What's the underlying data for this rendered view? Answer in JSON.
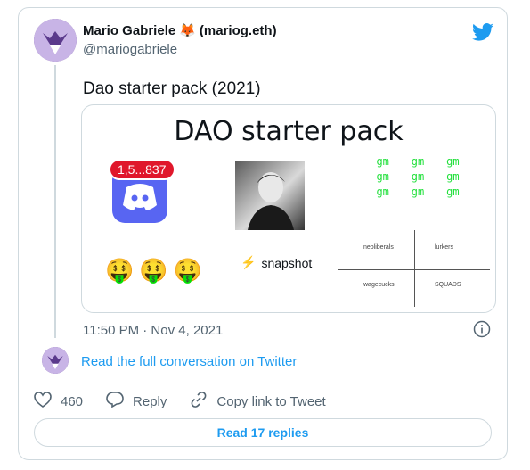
{
  "author": {
    "name": "Mario Gabriele",
    "emoji": "🦊",
    "name_suffix": "(mariog.eth)",
    "handle": "@mariogabriele"
  },
  "tweet": {
    "text": "Dao starter pack (2021)",
    "timestamp": "11:50 PM · Nov 4, 2021"
  },
  "media": {
    "title": "DAO starter pack",
    "discord_badge": "1,5...837",
    "gm_words": [
      "gm",
      "gm",
      "gm",
      "gm",
      "gm",
      "gm",
      "gm",
      "gm",
      "gm"
    ],
    "emojis": "🤑🤑🤑",
    "snapshot_icon": "⚡",
    "snapshot_label": "snapshot",
    "quadrants": {
      "top_left": "neoliberals",
      "top_right": "lurkers",
      "bottom_left": "wagecucks",
      "bottom_right": "SQUADS"
    }
  },
  "conversation_link": "Read the full conversation on Twitter",
  "actions": {
    "likes": "460",
    "reply_label": "Reply",
    "copy_label": "Copy link to Tweet"
  },
  "read_replies": "Read 17 replies",
  "icons": {
    "logo": "twitter-bird-icon",
    "info": "info-icon",
    "like": "heart-icon",
    "reply": "reply-bubble-icon",
    "copy": "link-icon"
  },
  "colors": {
    "accent": "#1d9bf0",
    "muted": "#536471",
    "border": "#cfd9de"
  }
}
